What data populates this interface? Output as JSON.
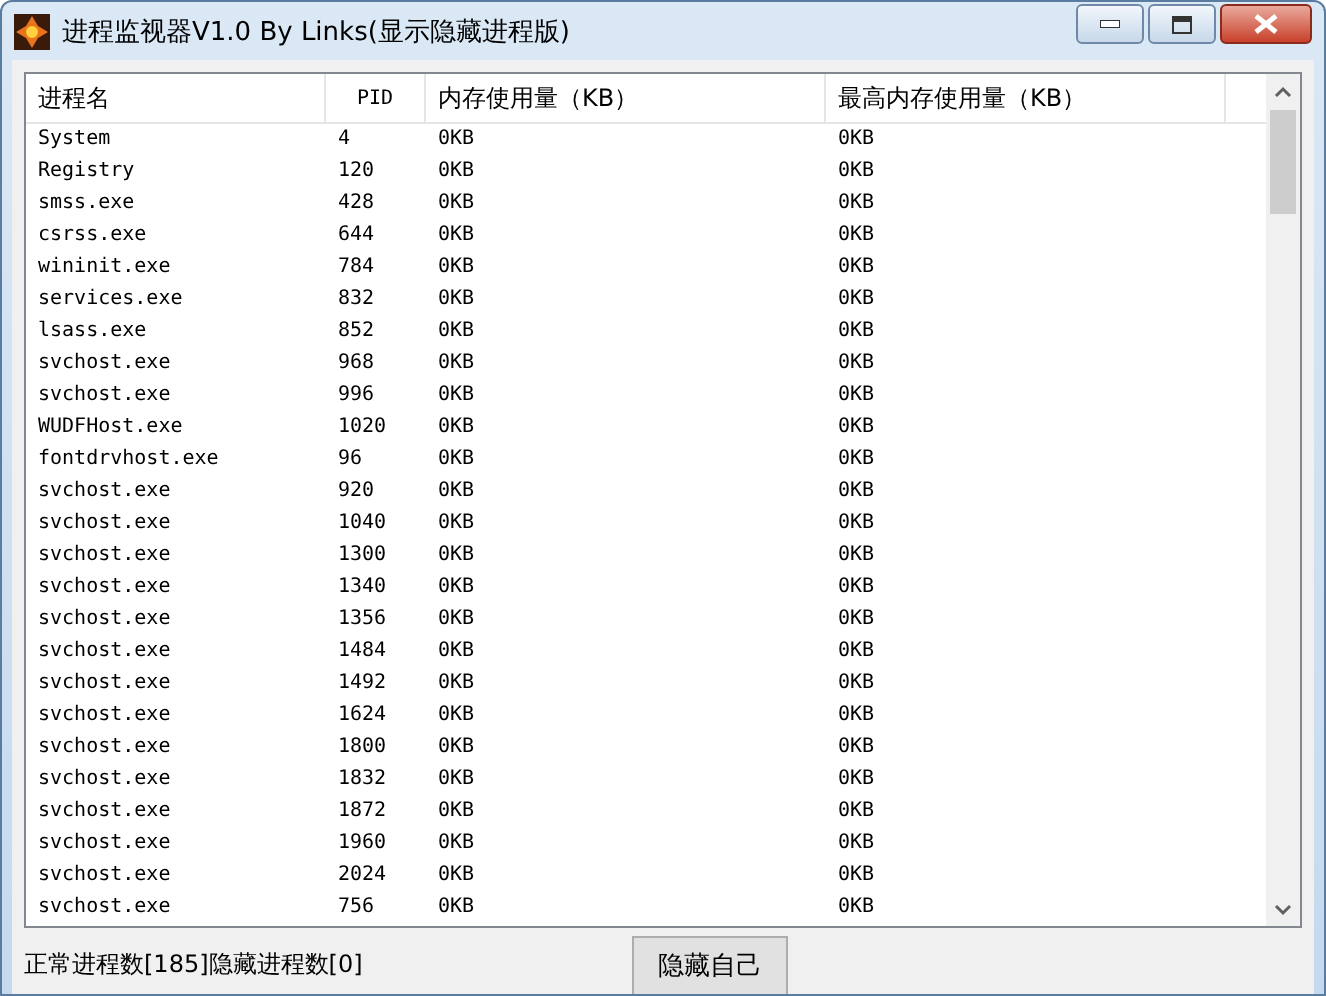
{
  "window": {
    "title": "进程监视器V1.0 By Links(显示隐藏进程版)"
  },
  "table": {
    "columns": [
      "进程名",
      "PID",
      "内存使用量（KB）",
      "最高内存使用量（KB）"
    ],
    "rows": [
      [
        "System",
        "4",
        "0KB",
        "0KB"
      ],
      [
        "Registry",
        "120",
        "0KB",
        "0KB"
      ],
      [
        "smss.exe",
        "428",
        "0KB",
        "0KB"
      ],
      [
        "csrss.exe",
        "644",
        "0KB",
        "0KB"
      ],
      [
        "wininit.exe",
        "784",
        "0KB",
        "0KB"
      ],
      [
        "services.exe",
        "832",
        "0KB",
        "0KB"
      ],
      [
        "lsass.exe",
        "852",
        "0KB",
        "0KB"
      ],
      [
        "svchost.exe",
        "968",
        "0KB",
        "0KB"
      ],
      [
        "svchost.exe",
        "996",
        "0KB",
        "0KB"
      ],
      [
        "WUDFHost.exe",
        "1020",
        "0KB",
        "0KB"
      ],
      [
        "fontdrvhost.exe",
        "96",
        "0KB",
        "0KB"
      ],
      [
        "svchost.exe",
        "920",
        "0KB",
        "0KB"
      ],
      [
        "svchost.exe",
        "1040",
        "0KB",
        "0KB"
      ],
      [
        "svchost.exe",
        "1300",
        "0KB",
        "0KB"
      ],
      [
        "svchost.exe",
        "1340",
        "0KB",
        "0KB"
      ],
      [
        "svchost.exe",
        "1356",
        "0KB",
        "0KB"
      ],
      [
        "svchost.exe",
        "1484",
        "0KB",
        "0KB"
      ],
      [
        "svchost.exe",
        "1492",
        "0KB",
        "0KB"
      ],
      [
        "svchost.exe",
        "1624",
        "0KB",
        "0KB"
      ],
      [
        "svchost.exe",
        "1800",
        "0KB",
        "0KB"
      ],
      [
        "svchost.exe",
        "1832",
        "0KB",
        "0KB"
      ],
      [
        "svchost.exe",
        "1872",
        "0KB",
        "0KB"
      ],
      [
        "svchost.exe",
        "1960",
        "0KB",
        "0KB"
      ],
      [
        "svchost.exe",
        "2024",
        "0KB",
        "0KB"
      ],
      [
        "svchost.exe",
        "756",
        "0KB",
        "0KB"
      ]
    ]
  },
  "status_bar": {
    "text": "正常进程数[185]隐藏进程数[0]",
    "button": "隐藏自己"
  }
}
